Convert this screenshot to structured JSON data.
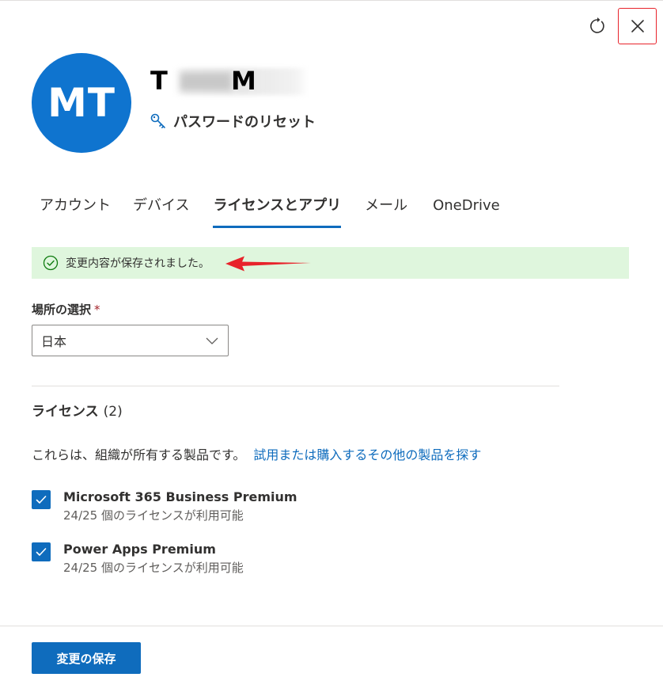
{
  "header": {
    "avatar_initials": "MT",
    "user_name_prefix": "T",
    "user_name_mid": "M",
    "reset_password_label": "パスワードのリセット",
    "icons": {
      "refresh": "refresh-icon",
      "close": "close-icon",
      "key": "key-icon"
    }
  },
  "tabs": [
    {
      "label": "アカウント",
      "active": false
    },
    {
      "label": "デバイス",
      "active": false
    },
    {
      "label": "ライセンスとアプリ",
      "active": true
    },
    {
      "label": "メール",
      "active": false
    },
    {
      "label": "OneDrive",
      "active": false
    }
  ],
  "banner": {
    "message": "変更内容が保存されました。",
    "icon": "check-circle-icon",
    "color": "#dff6dd"
  },
  "location": {
    "label": "場所の選択",
    "required_mark": "*",
    "selected_value": "日本"
  },
  "licenses": {
    "title": "ライセンス",
    "count": "(2)",
    "description": "これらは、組織が所有する製品です。",
    "link": "試用または購入するその他の製品を探す",
    "items": [
      {
        "name": "Microsoft 365 Business Premium",
        "availability": "24/25 個のライセンスが利用可能",
        "checked": true
      },
      {
        "name": "Power Apps Premium",
        "availability": "24/25 個のライセンスが利用可能",
        "checked": true
      }
    ]
  },
  "footer": {
    "save_label": "変更の保存"
  },
  "colors": {
    "accent": "#0f6cbd",
    "avatar": "#0f74cf",
    "success_bg": "#dff6dd",
    "success_icon": "#107c10",
    "annotation": "#e8232b"
  }
}
